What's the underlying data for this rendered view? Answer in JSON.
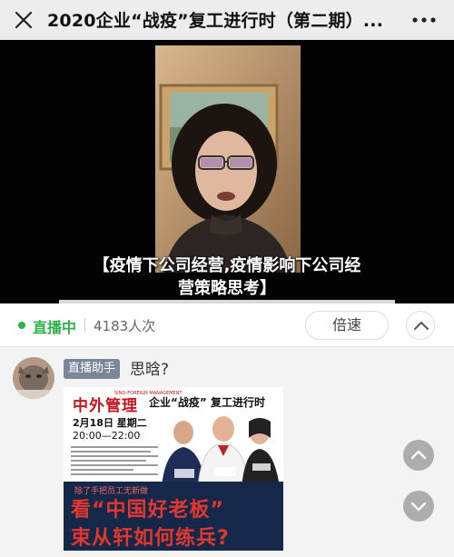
{
  "header": {
    "title": "2020企业“战疫”复工进行时（第二期）...",
    "close_icon": "close-icon",
    "more_icon": "more-dots-icon"
  },
  "video": {
    "caption_line1": "【疫情下公司经营,疫情影响下公司经",
    "caption_line2": "营策略思考】"
  },
  "status": {
    "live_label": "直播中",
    "viewers": "4183人次",
    "speed_label": "倍速",
    "live_color": "#2fb24a"
  },
  "chat": {
    "sender_badge": "直播助手",
    "message": "思晗?",
    "poster": {
      "logo": "中外管理",
      "logo_sub": "SINO-FOREIGN MANAGEMENT",
      "headline": "企业“战疫” 复工进行时",
      "date": "2月18日 星期二",
      "time": "20:00—22:00",
      "banner_small": "除了手把员工无新做",
      "banner_line1": "看“中国好老板”",
      "banner_line2": "束从轩如何练兵?"
    }
  },
  "fabs": {
    "up_icon": "chevron-up-icon",
    "down_icon": "chevron-down-icon"
  }
}
